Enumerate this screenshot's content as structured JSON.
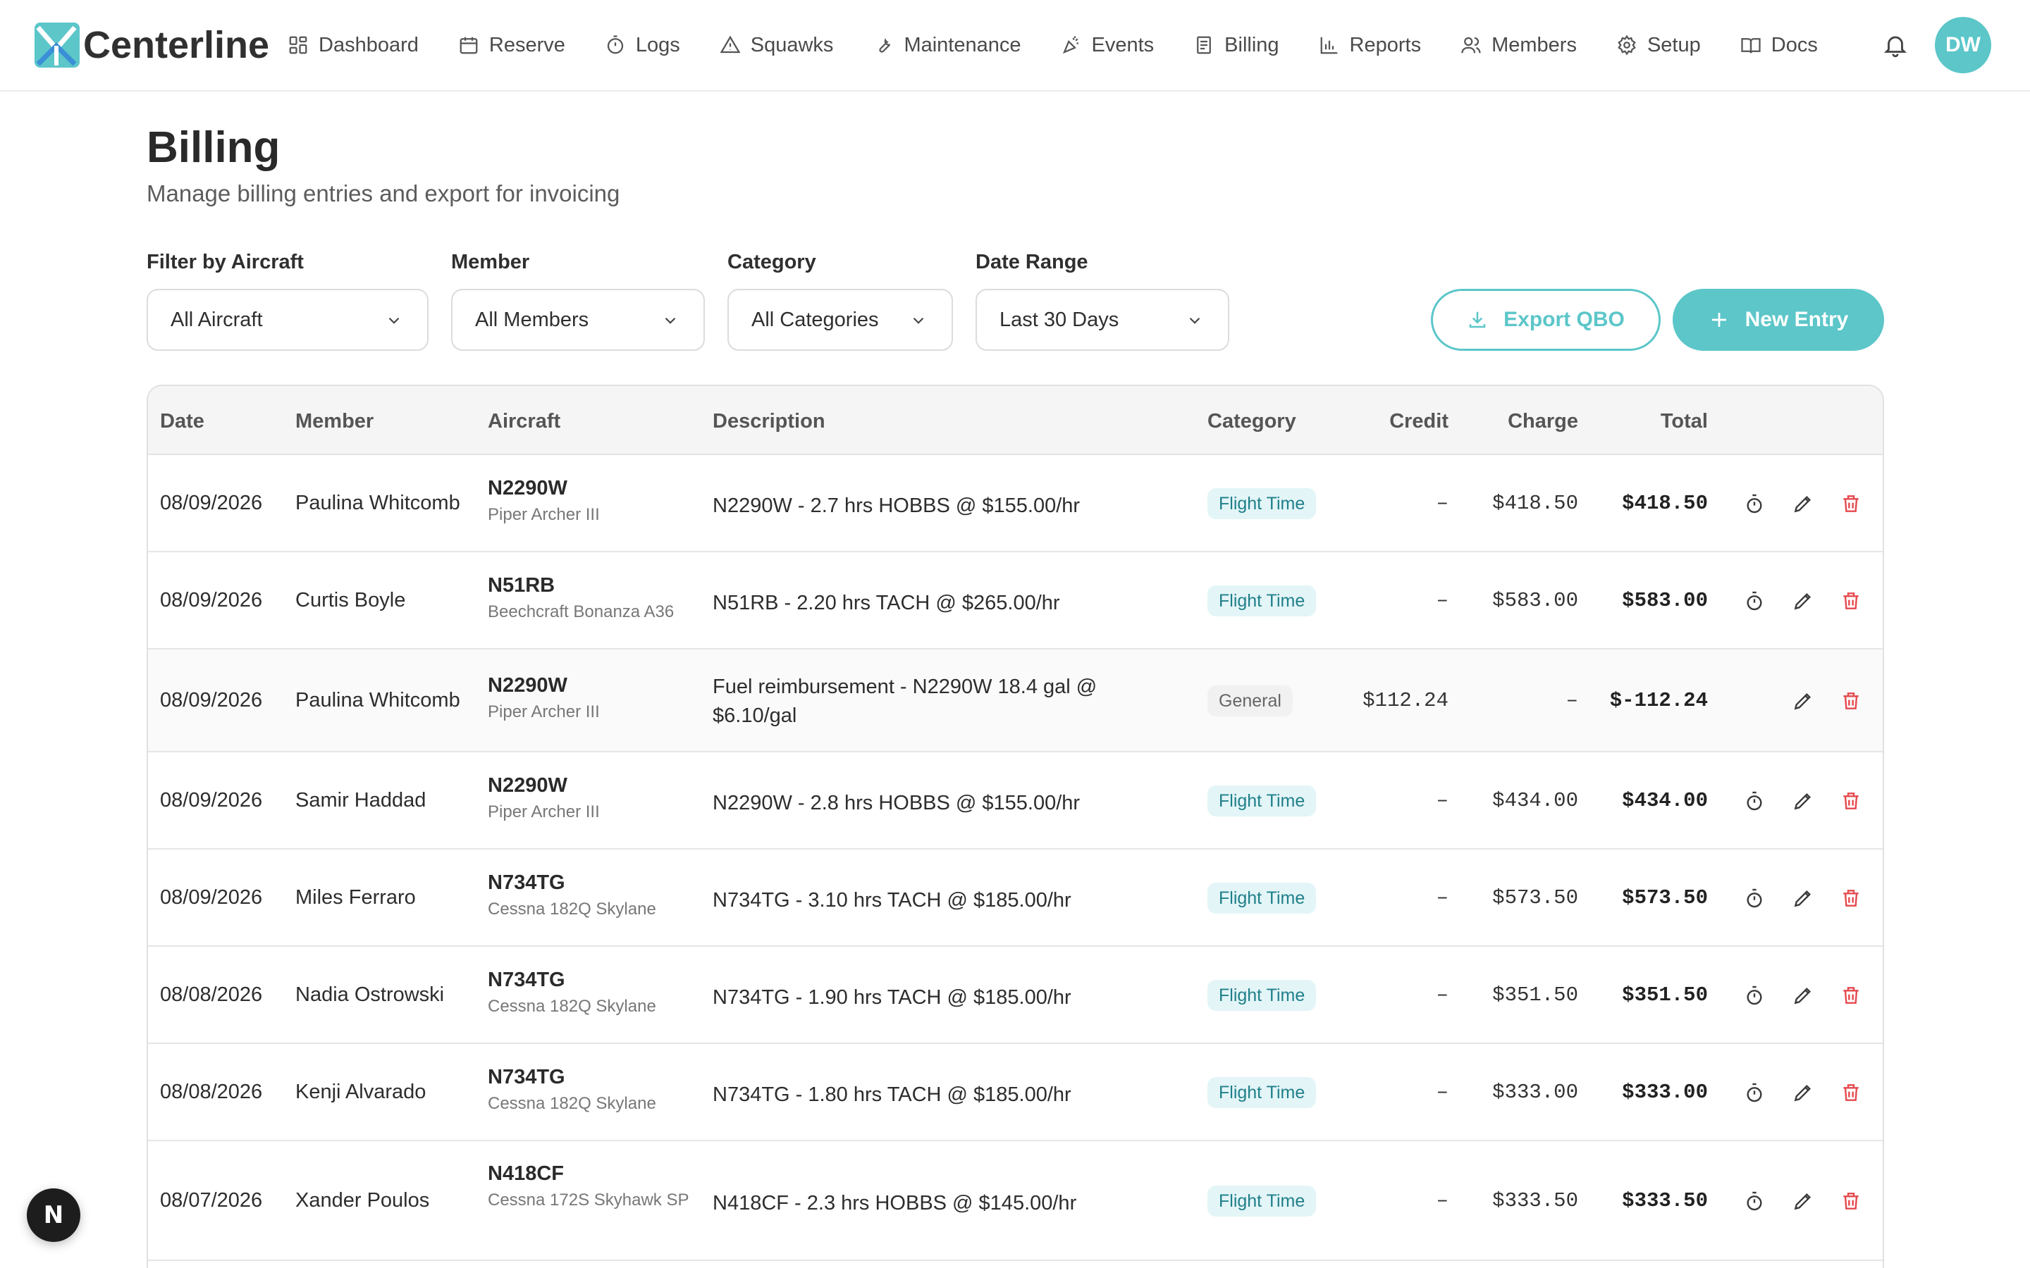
{
  "brand": {
    "name": "Centerline"
  },
  "nav": {
    "items": [
      {
        "label": "Dashboard",
        "icon": "grid-icon"
      },
      {
        "label": "Reserve",
        "icon": "calendar-icon"
      },
      {
        "label": "Logs",
        "icon": "stopwatch-icon"
      },
      {
        "label": "Squawks",
        "icon": "warning-triangle-icon"
      },
      {
        "label": "Maintenance",
        "icon": "wrench-icon"
      },
      {
        "label": "Events",
        "icon": "party-popper-icon"
      },
      {
        "label": "Billing",
        "icon": "receipt-icon"
      },
      {
        "label": "Reports",
        "icon": "bar-chart-icon"
      },
      {
        "label": "Members",
        "icon": "users-icon"
      },
      {
        "label": "Setup",
        "icon": "gear-icon"
      },
      {
        "label": "Docs",
        "icon": "book-icon"
      }
    ],
    "avatar_initials": "DW"
  },
  "header": {
    "title": "Billing",
    "subtitle": "Manage billing entries and export for invoicing"
  },
  "filters": {
    "aircraft": {
      "label": "Filter by Aircraft",
      "value": "All Aircraft"
    },
    "member": {
      "label": "Member",
      "value": "All Members"
    },
    "category": {
      "label": "Category",
      "value": "All Categories"
    },
    "date_range": {
      "label": "Date Range",
      "value": "Last 30 Days"
    }
  },
  "actions": {
    "export_label": "Export QBO",
    "new_label": "New Entry"
  },
  "table": {
    "headers": {
      "date": "Date",
      "member": "Member",
      "aircraft": "Aircraft",
      "description": "Description",
      "category": "Category",
      "credit": "Credit",
      "charge": "Charge",
      "total": "Total"
    },
    "rows": [
      {
        "date": "08/09/2026",
        "member": "Paulina Whitcomb",
        "reg": "N2290W",
        "model": "Piper Archer III",
        "description": "N2290W - 2.7 hrs HOBBS @ $155.00/hr",
        "category": "Flight Time",
        "credit": "–",
        "charge": "$418.50",
        "total": "$418.50",
        "has_timer": true
      },
      {
        "date": "08/09/2026",
        "member": "Curtis Boyle",
        "reg": "N51RB",
        "model": "Beechcraft Bonanza A36",
        "description": "N51RB - 2.20 hrs TACH @ $265.00/hr",
        "category": "Flight Time",
        "credit": "–",
        "charge": "$583.00",
        "total": "$583.00",
        "has_timer": true
      },
      {
        "date": "08/09/2026",
        "member": "Paulina Whitcomb",
        "reg": "N2290W",
        "model": "Piper Archer III",
        "description": "Fuel reimbursement - N2290W 18.4 gal @ $6.10/gal",
        "category": "General",
        "credit": "$112.24",
        "charge": "–",
        "total": "$-112.24",
        "has_timer": false
      },
      {
        "date": "08/09/2026",
        "member": "Samir Haddad",
        "reg": "N2290W",
        "model": "Piper Archer III",
        "description": "N2290W - 2.8 hrs HOBBS @ $155.00/hr",
        "category": "Flight Time",
        "credit": "–",
        "charge": "$434.00",
        "total": "$434.00",
        "has_timer": true
      },
      {
        "date": "08/09/2026",
        "member": "Miles Ferraro",
        "reg": "N734TG",
        "model": "Cessna 182Q Skylane",
        "description": "N734TG - 3.10 hrs TACH @ $185.00/hr",
        "category": "Flight Time",
        "credit": "–",
        "charge": "$573.50",
        "total": "$573.50",
        "has_timer": true
      },
      {
        "date": "08/08/2026",
        "member": "Nadia Ostrowski",
        "reg": "N734TG",
        "model": "Cessna 182Q Skylane",
        "description": "N734TG - 1.90 hrs TACH @ $185.00/hr",
        "category": "Flight Time",
        "credit": "–",
        "charge": "$351.50",
        "total": "$351.50",
        "has_timer": true
      },
      {
        "date": "08/08/2026",
        "member": "Kenji Alvarado",
        "reg": "N734TG",
        "model": "Cessna 182Q Skylane",
        "description": "N734TG - 1.80 hrs TACH @ $185.00/hr",
        "category": "Flight Time",
        "credit": "–",
        "charge": "$333.00",
        "total": "$333.00",
        "has_timer": true
      },
      {
        "date": "08/07/2026",
        "member": "Xander Poulos",
        "reg": "N418CF",
        "model": "Cessna 172S Skyhawk SP",
        "description": "N418CF - 2.3 hrs HOBBS @ $145.00/hr",
        "category": "Flight Time",
        "credit": "–",
        "charge": "$333.50",
        "total": "$333.50",
        "has_timer": true
      }
    ]
  },
  "fab": {
    "label": "N"
  },
  "colors": {
    "accent": "#5cc6c9",
    "danger": "#e5484d",
    "brand_blue": "#3a8fd6"
  }
}
